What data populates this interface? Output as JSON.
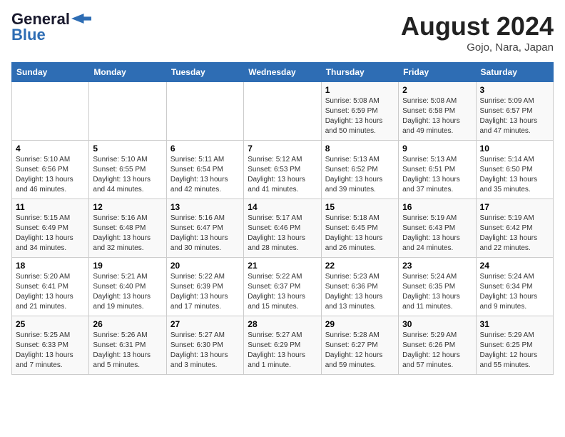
{
  "header": {
    "logo_general": "General",
    "logo_blue": "Blue",
    "month_title": "August 2024",
    "subtitle": "Gojo, Nara, Japan"
  },
  "weekdays": [
    "Sunday",
    "Monday",
    "Tuesday",
    "Wednesday",
    "Thursday",
    "Friday",
    "Saturday"
  ],
  "weeks": [
    [
      {
        "day": "",
        "info": ""
      },
      {
        "day": "",
        "info": ""
      },
      {
        "day": "",
        "info": ""
      },
      {
        "day": "",
        "info": ""
      },
      {
        "day": "1",
        "info": "Sunrise: 5:08 AM\nSunset: 6:59 PM\nDaylight: 13 hours\nand 50 minutes."
      },
      {
        "day": "2",
        "info": "Sunrise: 5:08 AM\nSunset: 6:58 PM\nDaylight: 13 hours\nand 49 minutes."
      },
      {
        "day": "3",
        "info": "Sunrise: 5:09 AM\nSunset: 6:57 PM\nDaylight: 13 hours\nand 47 minutes."
      }
    ],
    [
      {
        "day": "4",
        "info": "Sunrise: 5:10 AM\nSunset: 6:56 PM\nDaylight: 13 hours\nand 46 minutes."
      },
      {
        "day": "5",
        "info": "Sunrise: 5:10 AM\nSunset: 6:55 PM\nDaylight: 13 hours\nand 44 minutes."
      },
      {
        "day": "6",
        "info": "Sunrise: 5:11 AM\nSunset: 6:54 PM\nDaylight: 13 hours\nand 42 minutes."
      },
      {
        "day": "7",
        "info": "Sunrise: 5:12 AM\nSunset: 6:53 PM\nDaylight: 13 hours\nand 41 minutes."
      },
      {
        "day": "8",
        "info": "Sunrise: 5:13 AM\nSunset: 6:52 PM\nDaylight: 13 hours\nand 39 minutes."
      },
      {
        "day": "9",
        "info": "Sunrise: 5:13 AM\nSunset: 6:51 PM\nDaylight: 13 hours\nand 37 minutes."
      },
      {
        "day": "10",
        "info": "Sunrise: 5:14 AM\nSunset: 6:50 PM\nDaylight: 13 hours\nand 35 minutes."
      }
    ],
    [
      {
        "day": "11",
        "info": "Sunrise: 5:15 AM\nSunset: 6:49 PM\nDaylight: 13 hours\nand 34 minutes."
      },
      {
        "day": "12",
        "info": "Sunrise: 5:16 AM\nSunset: 6:48 PM\nDaylight: 13 hours\nand 32 minutes."
      },
      {
        "day": "13",
        "info": "Sunrise: 5:16 AM\nSunset: 6:47 PM\nDaylight: 13 hours\nand 30 minutes."
      },
      {
        "day": "14",
        "info": "Sunrise: 5:17 AM\nSunset: 6:46 PM\nDaylight: 13 hours\nand 28 minutes."
      },
      {
        "day": "15",
        "info": "Sunrise: 5:18 AM\nSunset: 6:45 PM\nDaylight: 13 hours\nand 26 minutes."
      },
      {
        "day": "16",
        "info": "Sunrise: 5:19 AM\nSunset: 6:43 PM\nDaylight: 13 hours\nand 24 minutes."
      },
      {
        "day": "17",
        "info": "Sunrise: 5:19 AM\nSunset: 6:42 PM\nDaylight: 13 hours\nand 22 minutes."
      }
    ],
    [
      {
        "day": "18",
        "info": "Sunrise: 5:20 AM\nSunset: 6:41 PM\nDaylight: 13 hours\nand 21 minutes."
      },
      {
        "day": "19",
        "info": "Sunrise: 5:21 AM\nSunset: 6:40 PM\nDaylight: 13 hours\nand 19 minutes."
      },
      {
        "day": "20",
        "info": "Sunrise: 5:22 AM\nSunset: 6:39 PM\nDaylight: 13 hours\nand 17 minutes."
      },
      {
        "day": "21",
        "info": "Sunrise: 5:22 AM\nSunset: 6:37 PM\nDaylight: 13 hours\nand 15 minutes."
      },
      {
        "day": "22",
        "info": "Sunrise: 5:23 AM\nSunset: 6:36 PM\nDaylight: 13 hours\nand 13 minutes."
      },
      {
        "day": "23",
        "info": "Sunrise: 5:24 AM\nSunset: 6:35 PM\nDaylight: 13 hours\nand 11 minutes."
      },
      {
        "day": "24",
        "info": "Sunrise: 5:24 AM\nSunset: 6:34 PM\nDaylight: 13 hours\nand 9 minutes."
      }
    ],
    [
      {
        "day": "25",
        "info": "Sunrise: 5:25 AM\nSunset: 6:33 PM\nDaylight: 13 hours\nand 7 minutes."
      },
      {
        "day": "26",
        "info": "Sunrise: 5:26 AM\nSunset: 6:31 PM\nDaylight: 13 hours\nand 5 minutes."
      },
      {
        "day": "27",
        "info": "Sunrise: 5:27 AM\nSunset: 6:30 PM\nDaylight: 13 hours\nand 3 minutes."
      },
      {
        "day": "28",
        "info": "Sunrise: 5:27 AM\nSunset: 6:29 PM\nDaylight: 13 hours\nand 1 minute."
      },
      {
        "day": "29",
        "info": "Sunrise: 5:28 AM\nSunset: 6:27 PM\nDaylight: 12 hours\nand 59 minutes."
      },
      {
        "day": "30",
        "info": "Sunrise: 5:29 AM\nSunset: 6:26 PM\nDaylight: 12 hours\nand 57 minutes."
      },
      {
        "day": "31",
        "info": "Sunrise: 5:29 AM\nSunset: 6:25 PM\nDaylight: 12 hours\nand 55 minutes."
      }
    ]
  ]
}
